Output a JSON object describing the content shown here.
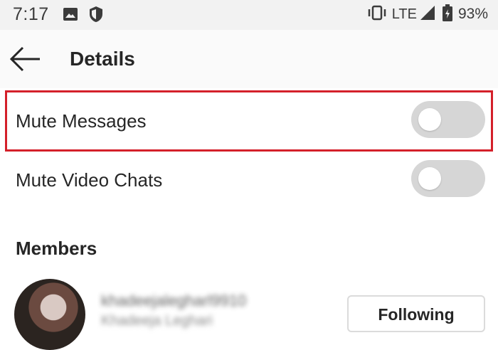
{
  "status_bar": {
    "time": "7:17",
    "network": "LTE",
    "battery": "93%",
    "icons": [
      "gallery-icon",
      "shield-icon",
      "vibrate-icon",
      "signal-icon",
      "battery-icon"
    ]
  },
  "header": {
    "title": "Details",
    "back_icon": "back-arrow-icon"
  },
  "settings": {
    "mute_messages": {
      "label": "Mute Messages",
      "enabled": false
    },
    "mute_video_chats": {
      "label": "Mute Video Chats",
      "enabled": false
    }
  },
  "members": {
    "heading": "Members",
    "items": [
      {
        "username": "khadeejalegharl9910",
        "subtitle": "Khadeeja Leghari",
        "button_label": "Following"
      }
    ]
  },
  "colors": {
    "highlight": "#d4202a",
    "toggle_off": "#d6d6d6",
    "header_bg": "#fafafa",
    "status_bg": "#f2f2f2"
  }
}
